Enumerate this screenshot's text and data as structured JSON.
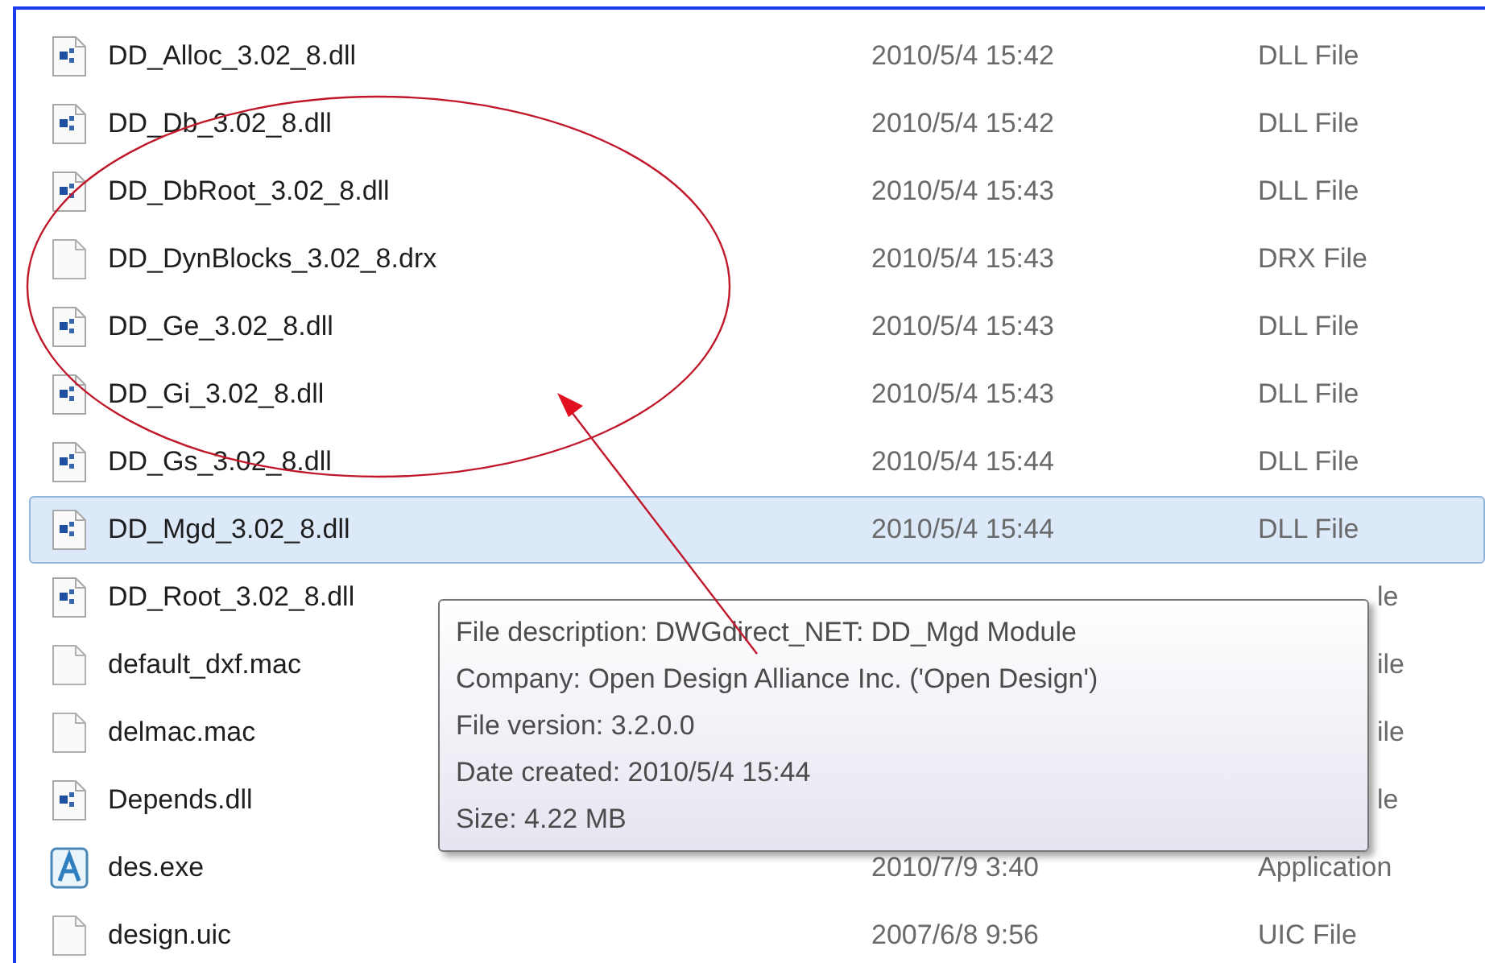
{
  "files": [
    {
      "kind": "dll",
      "name": "DD_Alloc_3.02_8.dll",
      "date": "2010/5/4 15:42",
      "type": "DLL File",
      "selected": false,
      "covered": false
    },
    {
      "kind": "dll",
      "name": "DD_Db_3.02_8.dll",
      "date": "2010/5/4 15:42",
      "type": "DLL File",
      "selected": false,
      "covered": false
    },
    {
      "kind": "dll",
      "name": "DD_DbRoot_3.02_8.dll",
      "date": "2010/5/4 15:43",
      "type": "DLL File",
      "selected": false,
      "covered": false
    },
    {
      "kind": "blank",
      "name": "DD_DynBlocks_3.02_8.drx",
      "date": "2010/5/4 15:43",
      "type": "DRX File",
      "selected": false,
      "covered": false
    },
    {
      "kind": "dll",
      "name": "DD_Ge_3.02_8.dll",
      "date": "2010/5/4 15:43",
      "type": "DLL File",
      "selected": false,
      "covered": false
    },
    {
      "kind": "dll",
      "name": "DD_Gi_3.02_8.dll",
      "date": "2010/5/4 15:43",
      "type": "DLL File",
      "selected": false,
      "covered": false
    },
    {
      "kind": "dll",
      "name": "DD_Gs_3.02_8.dll",
      "date": "2010/5/4 15:44",
      "type": "DLL File",
      "selected": false,
      "covered": false
    },
    {
      "kind": "dll",
      "name": "DD_Mgd_3.02_8.dll",
      "date": "2010/5/4 15:44",
      "type": "DLL File",
      "selected": true,
      "covered": false
    },
    {
      "kind": "dll",
      "name": "DD_Root_3.02_8.dll",
      "type": "le",
      "selected": false,
      "covered": true
    },
    {
      "kind": "blank",
      "name": "default_dxf.mac",
      "type": "ile",
      "selected": false,
      "covered": true
    },
    {
      "kind": "blank",
      "name": "delmac.mac",
      "type": "ile",
      "selected": false,
      "covered": true
    },
    {
      "kind": "dll",
      "name": "Depends.dll",
      "type": "le",
      "selected": false,
      "covered": true
    },
    {
      "kind": "app",
      "name": "des.exe",
      "date": "2010/7/9 3:40",
      "type": "Application",
      "selected": false,
      "covered": false
    },
    {
      "kind": "blank",
      "name": "design.uic",
      "date": "2007/6/8 9:56",
      "type": "UIC File",
      "selected": false,
      "covered": false
    }
  ],
  "tooltip": {
    "lines": [
      "File description: DWGdirect_NET: DD_Mgd Module",
      "Company: Open Design Alliance Inc. ('Open Design')",
      "File version: 3.2.0.0",
      "Date created: 2010/5/4 15:44",
      "Size: 4.22 MB"
    ]
  }
}
